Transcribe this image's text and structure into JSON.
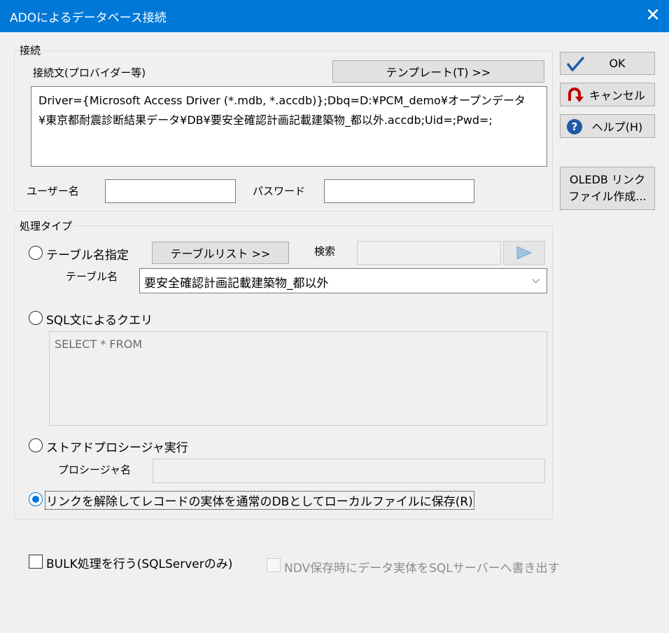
{
  "window": {
    "title": "ADOによるデータベース接続",
    "close_glyph": "✕"
  },
  "connection": {
    "group_label": "接続",
    "conn_string_label": "接続文(プロバイダー等)",
    "template_button": "テンプレート(T) >>",
    "conn_string_value": "Driver={Microsoft Access Driver (*.mdb, *.accdb)};Dbq=D:¥PCM_demo¥オープンデータ¥東京都耐震診断結果データ¥DB¥要安全確認計画記載建築物_都以外.accdb;Uid=;Pwd=;",
    "username_label": "ユーザー名",
    "username_value": "",
    "password_label": "パスワード",
    "password_value": ""
  },
  "processing": {
    "group_label": "処理タイプ",
    "table_option": "テーブル名指定",
    "table_list_button": "テーブルリスト >>",
    "search_label": "検索",
    "search_value": "",
    "table_name_label": "テーブル名",
    "table_name_value": "要安全確認計画記載建築物_都以外",
    "sql_option": "SQL文によるクエリ",
    "sql_value": "SELECT * FROM",
    "stored_proc_option": "ストアドプロシージャ実行",
    "procedure_name_label": "プロシージャ名",
    "procedure_name_value": "",
    "unlink_option": "リンクを解除してレコードの実体を通常のDBとしてローカルファイルに保存(R)",
    "selected_option": "unlink"
  },
  "bulk_checkbox": "BULK処理を行う(SQLServerのみ)",
  "ndv_checkbox": "NDV保存時にデータ実体をSQLサーバーへ書き出す",
  "buttons": {
    "ok": "OK",
    "cancel": "キャンセル",
    "help": "ヘルプ(H)",
    "oledb_line1": "OLEDB リンク",
    "oledb_line2": "ファイル作成..."
  },
  "colors": {
    "titlebar": "#0078d7",
    "accent": "#0078d7",
    "cancel_icon": "#c00000",
    "help_icon": "#1e5aa8",
    "ok_check": "#1e5aa8"
  }
}
